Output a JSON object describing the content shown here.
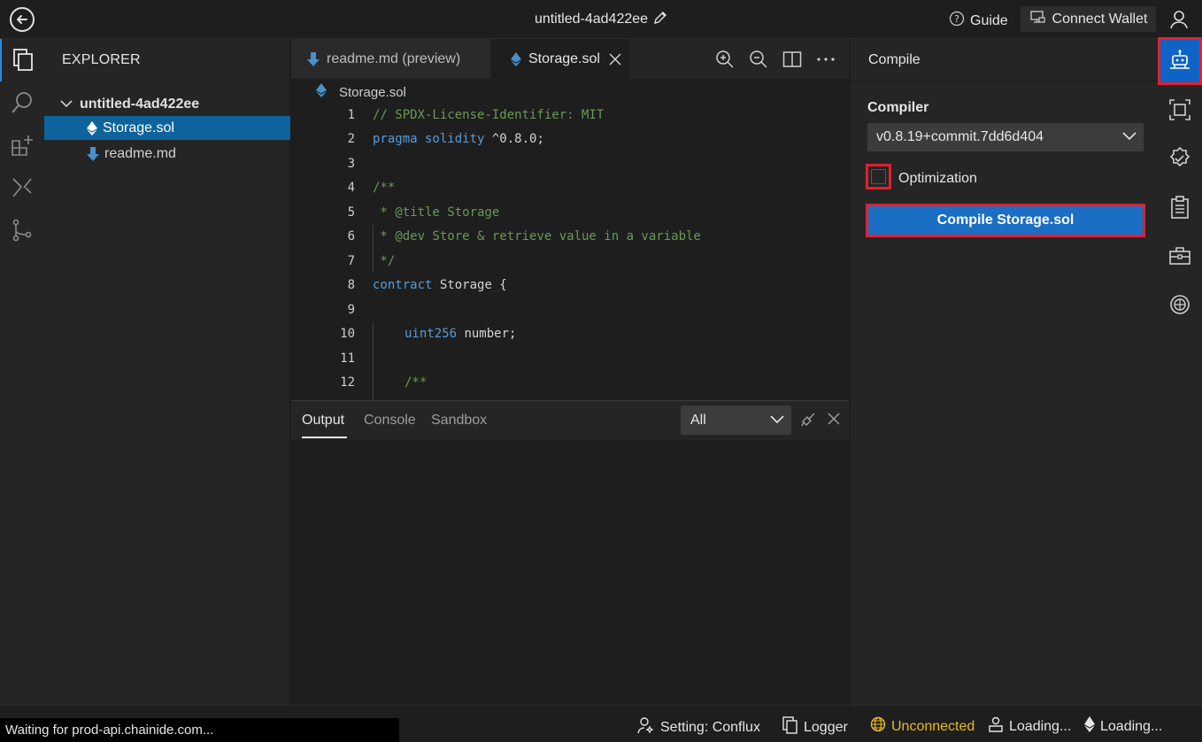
{
  "topbar": {
    "project_title": "untitled-4ad422ee",
    "guide_label": "Guide",
    "wallet_label": "Connect Wallet"
  },
  "explorer": {
    "title": "EXPLORER",
    "root": "untitled-4ad422ee",
    "files": [
      {
        "name": "Storage.sol",
        "selected": true
      },
      {
        "name": "readme.md",
        "selected": false
      }
    ]
  },
  "editor": {
    "tabs": [
      {
        "label": "readme.md (preview)",
        "active": false
      },
      {
        "label": "Storage.sol",
        "active": true
      }
    ],
    "breadcrumb": "Storage.sol",
    "lines": [
      {
        "n": "1",
        "text": "// SPDX-License-Identifier: MIT"
      },
      {
        "n": "2",
        "kw": "pragma solidity",
        "text": " ^0.8.0;"
      },
      {
        "n": "3",
        "text": ""
      },
      {
        "n": "4",
        "text": "/**"
      },
      {
        "n": "5",
        "text": " * @title Storage"
      },
      {
        "n": "6",
        "text": " * @dev Store & retrieve value in a variable"
      },
      {
        "n": "7",
        "text": " */"
      },
      {
        "n": "8",
        "kw": "contract",
        "text": " Storage {"
      },
      {
        "n": "9",
        "text": ""
      },
      {
        "n": "10",
        "kw": "uint256",
        "text": " number;"
      },
      {
        "n": "11",
        "text": ""
      },
      {
        "n": "12",
        "text": "/**"
      }
    ]
  },
  "panel": {
    "tabs": [
      "Output",
      "Console",
      "Sandbox"
    ],
    "active_tab": "Output",
    "filter_value": "All"
  },
  "compile": {
    "title": "Compile",
    "compiler_label": "Compiler",
    "compiler_version": "v0.8.19+commit.7dd6d404",
    "optimization_label": "Optimization",
    "optimization_checked": false,
    "button_label": "Compile Storage.sol"
  },
  "status": {
    "setting": "Setting: Conflux",
    "logger": "Logger",
    "connection": "Unconnected",
    "loading1": "Loading...",
    "loading2": "Loading...",
    "tooltip": "Waiting for prod-api.chainide.com..."
  },
  "colors": {
    "accent": "#0e639c",
    "button": "#1a6fc4",
    "highlight_border": "#e0212e",
    "warning": "#e8b923"
  }
}
